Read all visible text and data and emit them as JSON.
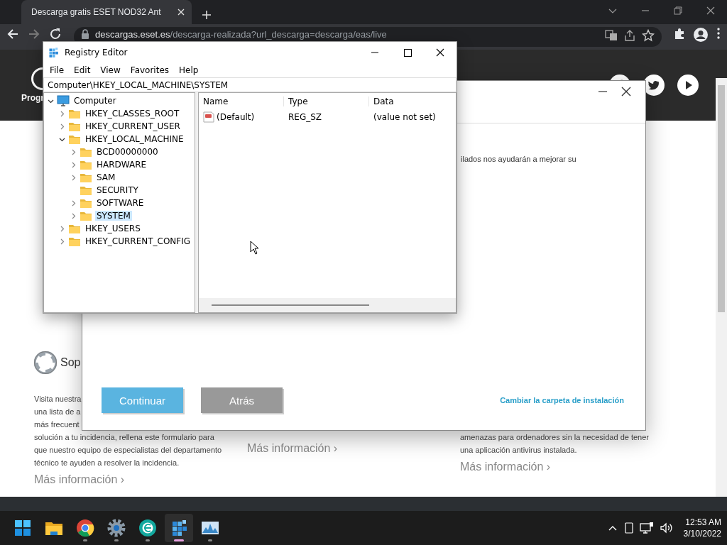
{
  "browser": {
    "tabs": [
      {
        "title": "Descarga gratis ESET NOD32 Ant",
        "selected": true
      }
    ],
    "url_host": "descargas.eset.es",
    "url_path": "/descarga-realizada?url_descarga=descarga/eas/live"
  },
  "website": {
    "logo_text": "Progr",
    "support_heading": "Sop",
    "columns": [
      {
        "lines": [
          "Visita nuestra",
          "una lista de a",
          "más frecuent",
          "solución a tu incidencia, rellena este formulario para",
          "que nuestro equipo de especialistas del departamento",
          "técnico te ayuden a resolver la incidencia."
        ],
        "more": "Más información ›"
      },
      {
        "more": "Más información ›"
      },
      {
        "lines": [
          "amenazas para ordenadores sin la necesidad de tener",
          "una aplicación antivirus instalada."
        ],
        "more": "Más información ›"
      }
    ]
  },
  "installer": {
    "text": "ilados nos ayudarán a mejorar su",
    "buttons": [
      {
        "label": "Continuar",
        "kind": "primary"
      },
      {
        "label": "Atrás",
        "kind": "secondary"
      }
    ],
    "link": "Cambiar la carpeta de instalación"
  },
  "registry_editor": {
    "title": "Registry Editor",
    "menu": [
      "File",
      "Edit",
      "View",
      "Favorites",
      "Help"
    ],
    "address": "Computer\\HKEY_LOCAL_MACHINE\\SYSTEM",
    "tree": [
      {
        "label": "Computer",
        "kind": "computer",
        "expandable": true,
        "expanded": true,
        "selected": false,
        "children": [
          {
            "label": "HKEY_CLASSES_ROOT",
            "kind": "folder",
            "expandable": true,
            "expanded": false,
            "selected": false
          },
          {
            "label": "HKEY_CURRENT_USER",
            "kind": "folder",
            "expandable": true,
            "expanded": false,
            "selected": false
          },
          {
            "label": "HKEY_LOCAL_MACHINE",
            "kind": "folder",
            "expandable": true,
            "expanded": true,
            "selected": false,
            "children": [
              {
                "label": "BCD00000000",
                "kind": "folder",
                "expandable": true,
                "expanded": false,
                "selected": false
              },
              {
                "label": "HARDWARE",
                "kind": "folder",
                "expandable": true,
                "expanded": false,
                "selected": false
              },
              {
                "label": "SAM",
                "kind": "folder",
                "expandable": true,
                "expanded": false,
                "selected": false
              },
              {
                "label": "SECURITY",
                "kind": "folder",
                "expandable": false,
                "expanded": false,
                "selected": false
              },
              {
                "label": "SOFTWARE",
                "kind": "folder",
                "expandable": true,
                "expanded": false,
                "selected": false
              },
              {
                "label": "SYSTEM",
                "kind": "folder",
                "expandable": true,
                "expanded": false,
                "selected": true
              }
            ]
          },
          {
            "label": "HKEY_USERS",
            "kind": "folder",
            "expandable": true,
            "expanded": false,
            "selected": false
          },
          {
            "label": "HKEY_CURRENT_CONFIG",
            "kind": "folder",
            "expandable": true,
            "expanded": false,
            "selected": false
          }
        ]
      }
    ],
    "columns": [
      "Name",
      "Type",
      "Data"
    ],
    "values": [
      {
        "name": "(Default)",
        "type": "REG_SZ",
        "data": "(value not set)"
      }
    ]
  },
  "taskbar": {
    "apps": [
      {
        "kind": "start",
        "running": false,
        "active": false
      },
      {
        "kind": "files",
        "running": false,
        "active": false
      },
      {
        "kind": "chrome",
        "running": true,
        "active": false
      },
      {
        "kind": "settings",
        "running": true,
        "active": false
      },
      {
        "kind": "eset",
        "running": true,
        "active": false
      },
      {
        "kind": "regedit",
        "running": true,
        "active": true
      },
      {
        "kind": "monitor",
        "running": true,
        "active": false
      }
    ],
    "time": "12:53 AM",
    "date": "3/10/2022"
  }
}
